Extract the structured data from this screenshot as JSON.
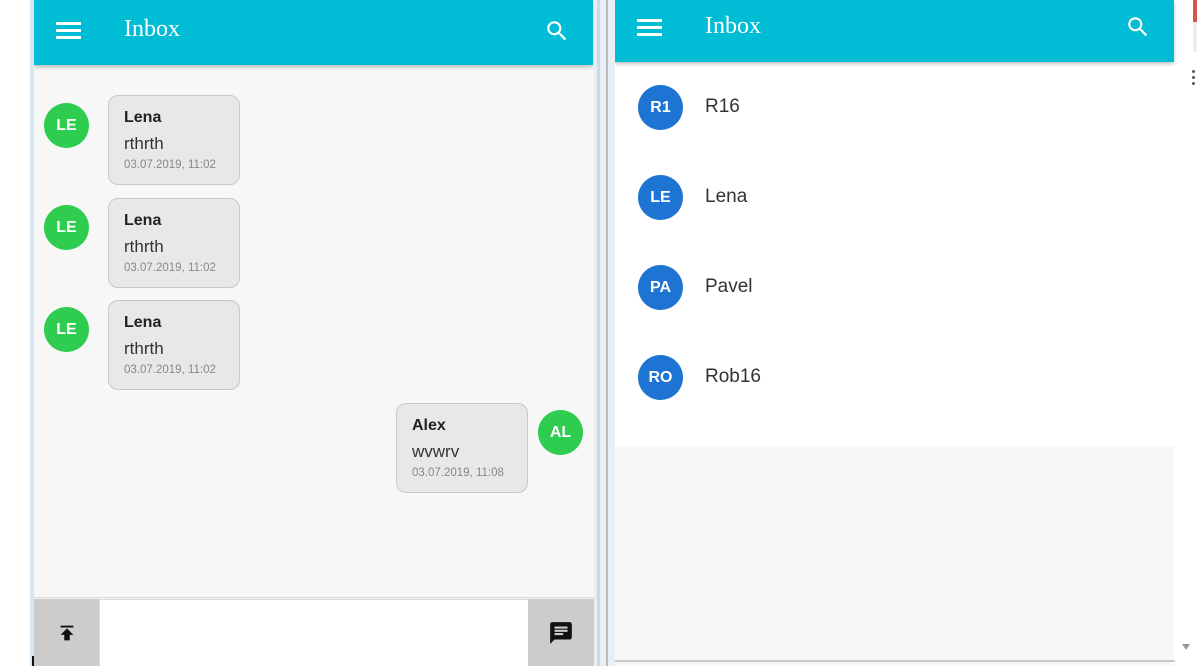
{
  "left": {
    "title": "Inbox",
    "messages": [
      {
        "initials": "LE",
        "name": "Lena",
        "text": "rthrth",
        "time": "03.07.2019, 11:02",
        "color": "#2ecc4f"
      },
      {
        "initials": "LE",
        "name": "Lena",
        "text": "rthrth",
        "time": "03.07.2019, 11:02",
        "color": "#2ecc4f"
      },
      {
        "initials": "LE",
        "name": "Lena",
        "text": "rthrth",
        "time": "03.07.2019, 11:02",
        "color": "#2ecc4f"
      },
      {
        "initials": "AL",
        "name": "Alex",
        "text": "wvwrv",
        "time": "03.07.2019, 11:08",
        "color": "#2ecc4f"
      }
    ],
    "composer": {
      "value": "",
      "placeholder": ""
    }
  },
  "right": {
    "title": "Inbox",
    "contacts": [
      {
        "initials": "R1",
        "name": "R16"
      },
      {
        "initials": "LE",
        "name": "Lena"
      },
      {
        "initials": "PA",
        "name": "Pavel"
      },
      {
        "initials": "RO",
        "name": "Rob16"
      }
    ]
  },
  "colors": {
    "appbar": "#00bcd4",
    "avatar_green": "#2ecc4f",
    "avatar_blue": "#1e74d2",
    "bubble": "#e8e8e8"
  },
  "icons": [
    "menu-icon",
    "search-icon",
    "upload-icon",
    "send-message-icon"
  ]
}
